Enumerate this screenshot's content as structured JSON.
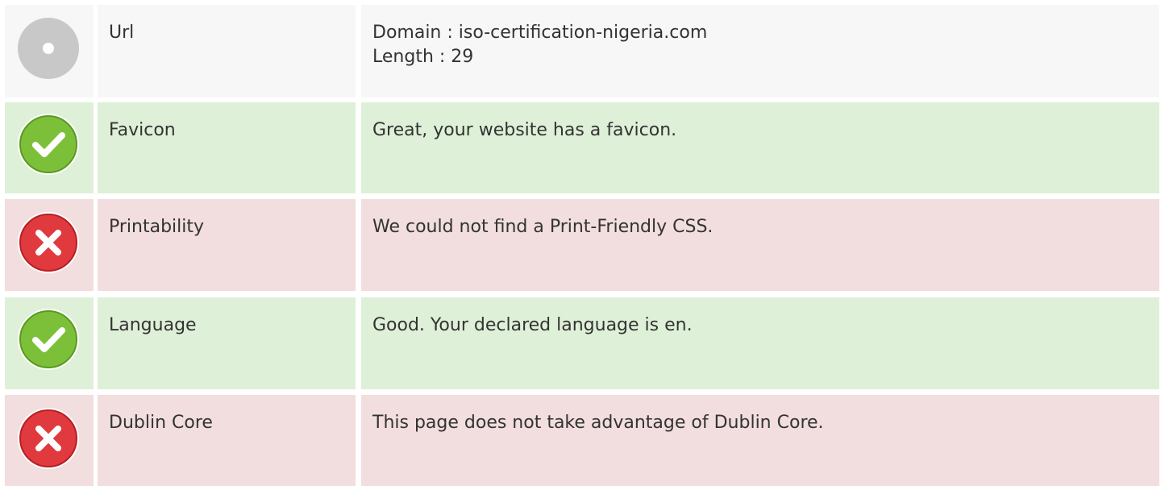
{
  "rows": [
    {
      "status": "neutral",
      "icon": "neutral-circle-icon",
      "label": "Url",
      "lines": [
        "Domain : iso-certification-nigeria.com",
        "Length : 29"
      ]
    },
    {
      "status": "pass",
      "icon": "check-icon",
      "label": "Favicon",
      "lines": [
        "Great, your website has a favicon."
      ]
    },
    {
      "status": "fail",
      "icon": "cross-icon",
      "label": "Printability",
      "lines": [
        "We could not find a Print-Friendly CSS."
      ]
    },
    {
      "status": "pass",
      "icon": "check-icon",
      "label": "Language",
      "lines": [
        "Good. Your declared language is en."
      ]
    },
    {
      "status": "fail",
      "icon": "cross-icon",
      "label": "Dublin Core",
      "lines": [
        "This page does not take advantage of Dublin Core."
      ]
    }
  ],
  "colors": {
    "neutral_bg": "#f7f7f7",
    "pass_bg": "#dff0d8",
    "fail_bg": "#f2dede",
    "pass_icon": "#7cc03a",
    "fail_icon": "#e0393e",
    "neutral_icon": "#c8c8c8"
  }
}
